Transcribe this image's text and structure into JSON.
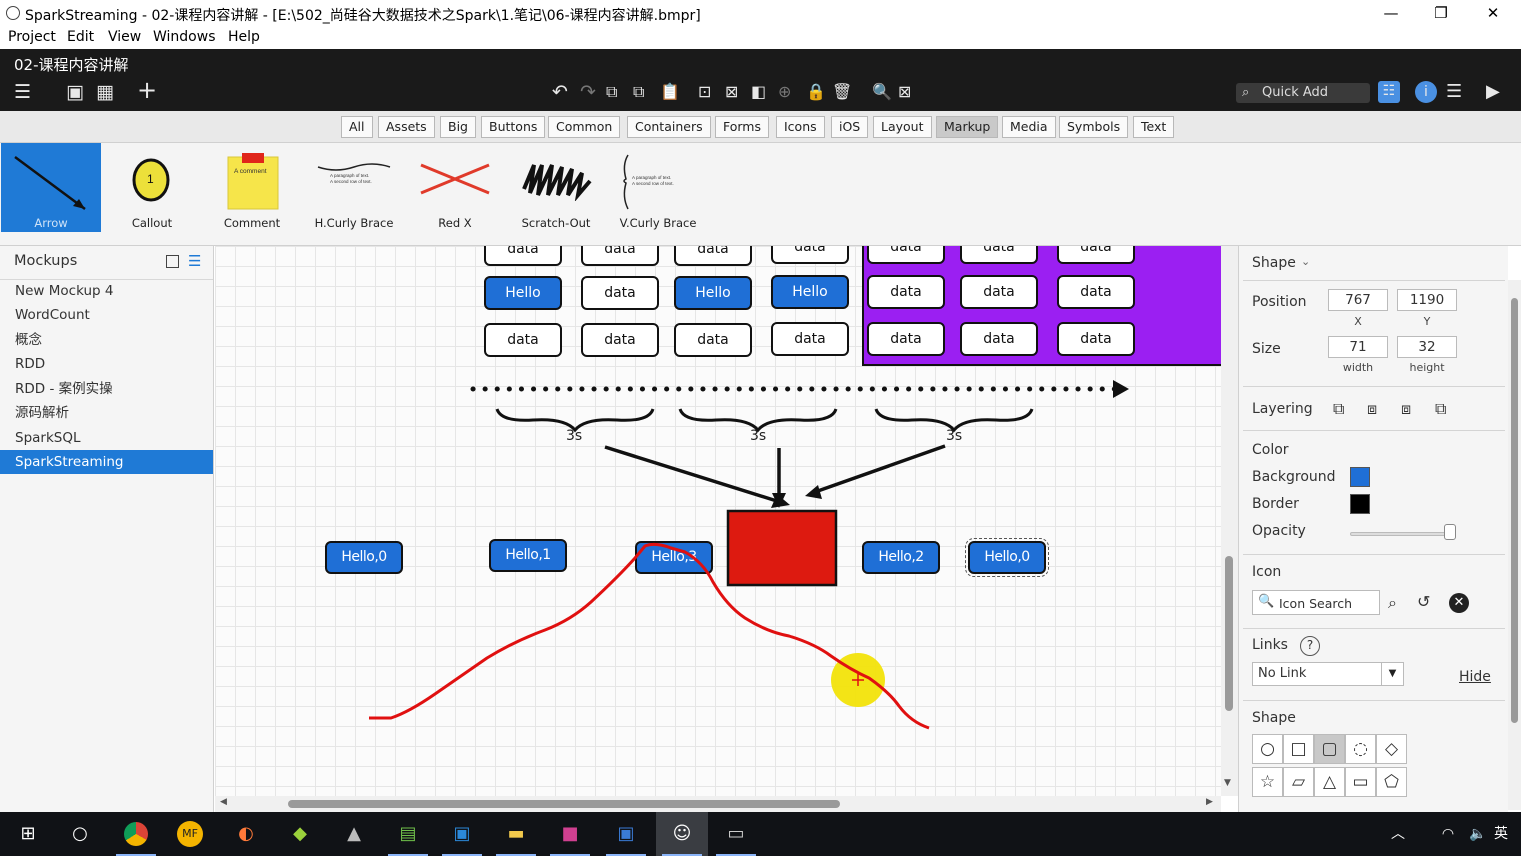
{
  "window": {
    "title": "SparkStreaming - 02-课程内容讲解 - [E:\\502_尚硅谷大数据技术之Spark\\1.笔记\\06-课程内容讲解.bmpr]",
    "minimize": "—",
    "maximize": "❐",
    "close": "✕"
  },
  "menu": [
    "Project",
    "Edit",
    "View",
    "Windows",
    "Help"
  ],
  "toolbar": {
    "doc_title": "02-课程内容讲解",
    "quick_add_placeholder": "Quick Add"
  },
  "categories": {
    "items": [
      "All",
      "Assets",
      "Big",
      "Buttons",
      "Common",
      "Containers",
      "Forms",
      "Icons",
      "iOS",
      "Layout",
      "Markup",
      "Media",
      "Symbols",
      "Text"
    ],
    "active": "Markup"
  },
  "components": [
    {
      "label": "Arrow",
      "icon": "arrow-icon",
      "active": true
    },
    {
      "label": "Callout",
      "icon": "callout-icon",
      "callout_number": "1"
    },
    {
      "label": "Comment",
      "icon": "sticky-note-icon",
      "note_text": "A comment"
    },
    {
      "label": "H.Curly Brace",
      "icon": "h-curly-brace-icon",
      "preview_lines": [
        "A paragraph of text.",
        "A second row of text."
      ]
    },
    {
      "label": "Red X",
      "icon": "red-x-icon"
    },
    {
      "label": "Scratch-Out",
      "icon": "scratch-out-icon"
    },
    {
      "label": "V.Curly Brace",
      "icon": "v-curly-brace-icon",
      "preview_lines": [
        "A paragraph of text.",
        "A second row of text."
      ]
    }
  ],
  "mockups": {
    "header": "Mockups",
    "items": [
      "New Mockup 4",
      "WordCount",
      "概念",
      "RDD",
      "RDD - 案例实操",
      "源码解析",
      "SparkSQL",
      "SparkStreaming"
    ],
    "selected": "SparkStreaming"
  },
  "canvas": {
    "row0": [
      "data",
      "data",
      "data",
      "data",
      "data",
      "data",
      "data"
    ],
    "row1": [
      "Hello",
      "data",
      "Hello",
      "Hello",
      "data",
      "data",
      "data"
    ],
    "row2": [
      "data",
      "data",
      "data",
      "data",
      "data",
      "data",
      "data"
    ],
    "brace_labels": [
      "3s",
      "3s",
      "3s"
    ],
    "bottom_buttons": [
      "Hello,0",
      "Hello,1",
      "Hello,3",
      "Hello,2",
      "Hello,0"
    ],
    "colors": {
      "blue_button": "#1f6fd6",
      "purple_container": "#9b1ff2",
      "red_box": "#dd1a10",
      "freehand_line": "#e01010",
      "cursor_highlight": "#f2e30a"
    }
  },
  "inspector": {
    "header": "Shape",
    "position_label": "Position",
    "x": "767",
    "x_label": "X",
    "y": "1190",
    "y_label": "Y",
    "size_label": "Size",
    "width": "71",
    "width_label": "width",
    "height": "32",
    "height_label": "height",
    "layering_label": "Layering",
    "color_label": "Color",
    "background_label": "Background",
    "background_color": "#1f6fd6",
    "border_label": "Border",
    "border_color": "#000000",
    "opacity_label": "Opacity",
    "opacity": 0.96,
    "icon_label": "Icon",
    "icon_search_placeholder": "Icon Search",
    "links_label": "Links",
    "links_help": "?",
    "link_value": "No Link",
    "hide_link": "Hide",
    "shape_label": "Shape"
  },
  "taskbar": {
    "ime": "英"
  }
}
